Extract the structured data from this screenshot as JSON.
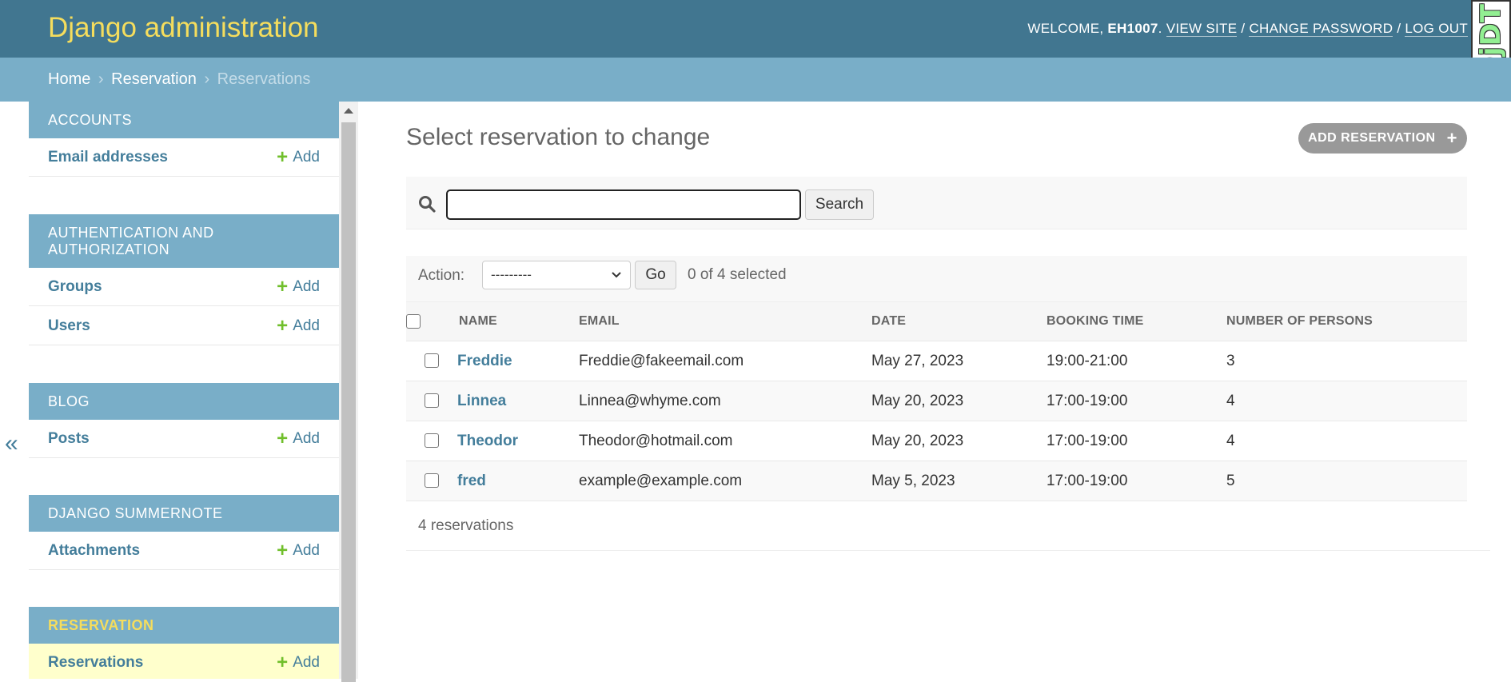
{
  "header": {
    "branding": "Django administration",
    "welcome_prefix": "WELCOME, ",
    "username": "EH1007",
    "welcome_suffix": ". ",
    "view_site": "VIEW SITE",
    "sep1": " / ",
    "change_password": "CHANGE PASSWORD",
    "sep2": " / ",
    "log_out": "LOG OUT",
    "djdt": "DjDT"
  },
  "breadcrumbs": {
    "home": "Home",
    "sep": "›",
    "app": "Reservation",
    "current": "Reservations"
  },
  "nav_toggle": "«",
  "sidebar": {
    "modules": [
      {
        "caption": "ACCOUNTS",
        "models": [
          {
            "name": "Email addresses",
            "add": "Add"
          }
        ]
      },
      {
        "caption": "AUTHENTICATION AND AUTHORIZATION",
        "models": [
          {
            "name": "Groups",
            "add": "Add"
          },
          {
            "name": "Users",
            "add": "Add"
          }
        ]
      },
      {
        "caption": "BLOG",
        "models": [
          {
            "name": "Posts",
            "add": "Add"
          }
        ]
      },
      {
        "caption": "DJANGO SUMMERNOTE",
        "models": [
          {
            "name": "Attachments",
            "add": "Add"
          }
        ]
      },
      {
        "caption": "RESERVATION",
        "models": [
          {
            "name": "Reservations",
            "add": "Add"
          }
        ]
      }
    ],
    "plus": "+"
  },
  "content": {
    "title": "Select reservation to change",
    "add_button": "ADD RESERVATION",
    "add_plus": "+",
    "search": {
      "value": "",
      "button": "Search"
    },
    "actions": {
      "label": "Action:",
      "selected": "---------",
      "go": "Go",
      "count": "0 of 4 selected"
    },
    "table": {
      "headers": [
        "NAME",
        "EMAIL",
        "DATE",
        "BOOKING TIME",
        "NUMBER OF PERSONS"
      ],
      "rows": [
        {
          "name": "Freddie",
          "email": "Freddie@fakeemail.com",
          "date": "May 27, 2023",
          "time": "19:00-21:00",
          "persons": "3"
        },
        {
          "name": "Linnea",
          "email": "Linnea@whyme.com",
          "date": "May 20, 2023",
          "time": "17:00-19:00",
          "persons": "4"
        },
        {
          "name": "Theodor",
          "email": "Theodor@hotmail.com",
          "date": "May 20, 2023",
          "time": "17:00-19:00",
          "persons": "4"
        },
        {
          "name": "fred",
          "email": "example@example.com",
          "date": "May 5, 2023",
          "time": "17:00-19:00",
          "persons": "5"
        }
      ]
    },
    "paginator": "4 reservations"
  },
  "colors": {
    "header": "#417690",
    "breadcrumbs": "#79aec8",
    "branding": "#f5dd5d",
    "link": "#447e9b",
    "add_green": "#70bf2b",
    "current_row": "#ffffcc"
  }
}
